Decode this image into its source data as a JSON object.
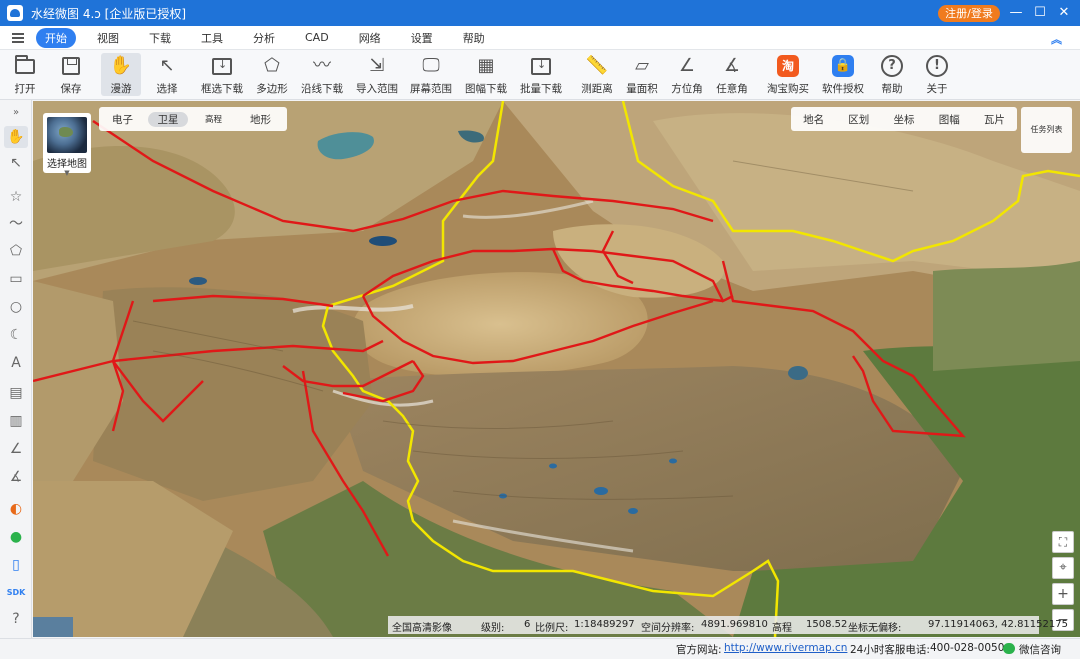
{
  "window": {
    "title": "水经微图 4.ɔ [企业版已授权]",
    "login_button": "注册/登录",
    "minimize": "—",
    "maximize": "☐",
    "close": "✕"
  },
  "menu": {
    "tabs": [
      "开始",
      "视图",
      "下载",
      "工具",
      "分析",
      "CAD",
      "网络",
      "设置",
      "帮助"
    ],
    "active_index": 0
  },
  "toolbar": {
    "open": "打开",
    "save": "保存",
    "pan": "漫游",
    "select": "选择",
    "box_download": "框选下载",
    "polygon": "多边形",
    "line_download": "沿线下载",
    "import_range": "导入范围",
    "screen_range": "屏幕范围",
    "sheet_download": "图幅下载",
    "batch_download": "批量下载",
    "measure_distance": "测距离",
    "measure_area": "量面积",
    "azimuth": "方位角",
    "any_angle": "任意角",
    "taobao_buy": "淘宝购买",
    "software_license": "软件授权",
    "help": "帮助",
    "about": "关于",
    "taobao_icon_text": "淘"
  },
  "map": {
    "map_selector_label": "选择地图",
    "map_types": [
      "电子",
      "卫星",
      "高程",
      "地形"
    ],
    "active_map_type": "卫星",
    "layers": [
      "地名",
      "区划",
      "坐标",
      "图幅",
      "瓦片"
    ],
    "task_list": "任务列表",
    "status": {
      "imagery": "全国高清影像",
      "level_label": "级别:",
      "level": "6",
      "scale_label": "比例尺:",
      "scale": "1:18489297",
      "resolution_label": "空间分辨率:",
      "resolution": "4891.969810",
      "elevation_label": "高程",
      "elevation": "1508.52",
      "offset_label": "坐标无偏移:",
      "coords": "97.11914063, 42.81152175"
    },
    "colors": {
      "boundary_red": "#e01818",
      "boundary_yellow": "#f2e600"
    }
  },
  "footer": {
    "website_label": "官方网站:",
    "website": "http://www.rivermap.cn",
    "hotline_label": "24小时客服电话:",
    "hotline": "400-028-0050",
    "wechat": "微信咨询"
  }
}
